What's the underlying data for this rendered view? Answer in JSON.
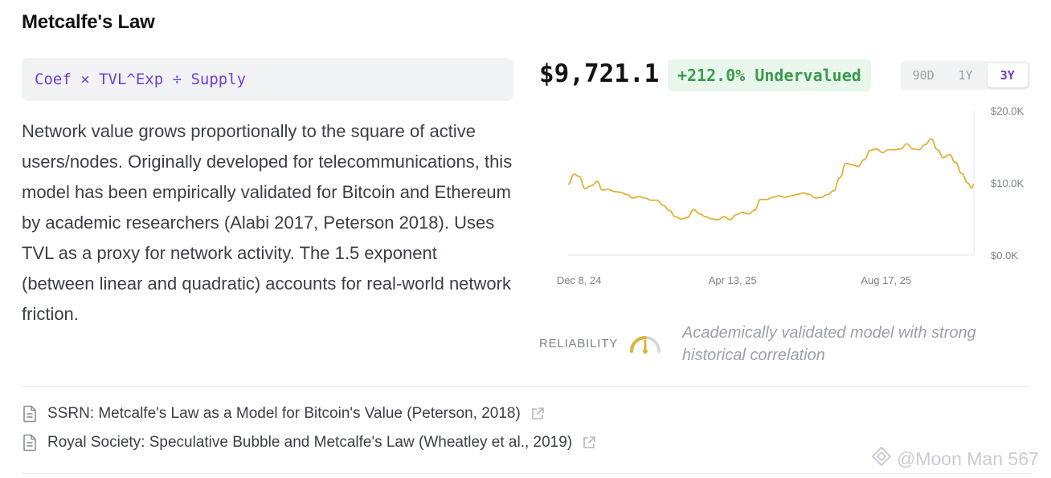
{
  "header": {
    "title": "Metcalfe's Law"
  },
  "formula": "Coef × TVL^Exp ÷ Supply",
  "description": "Network value grows proportionally to the square of active users/nodes. Originally developed for telecommunications, this model has been empirically validated for Bitcoin and Ethereum by academic researchers (Alabi 2017, Peterson 2018). Uses TVL as a proxy for network activity. The 1.5 exponent (between linear and quadratic) accounts for real-world network friction.",
  "price": "$9,721.1",
  "valuation_badge": "+212.0% Undervalued",
  "range_selector": {
    "options": [
      "90D",
      "1Y",
      "3Y"
    ],
    "selected": "3Y"
  },
  "reliability": {
    "label": "RELIABILITY",
    "note": "Academically validated model with strong historical correlation",
    "level": 0.5
  },
  "sources": [
    {
      "label": "SSRN: Metcalfe's Law as a Model for Bitcoin's Value (Peterson, 2018)",
      "icon": "document-icon",
      "link_icon": "external-link-icon"
    },
    {
      "label": "Royal Society: Speculative Bubble and Metcalfe's Law (Wheatley et al., 2019)",
      "icon": "document-icon",
      "link_icon": "external-link-icon"
    }
  ],
  "watermark": "@Moon Man 567",
  "colors": {
    "accent": "#6d3fd6",
    "line": "#e0b23a",
    "positive": "#3a9b4f",
    "badge_bg": "#e9f6ec"
  },
  "chart_data": {
    "type": "line",
    "x_ticks": [
      "Dec 8, 24",
      "Apr 13, 25",
      "Aug 17, 25"
    ],
    "y_ticks": [
      "$0.0K",
      "$10.0K",
      "$20.0K"
    ],
    "ylim": [
      0,
      20000
    ],
    "x_range": [
      "2024-11-29",
      "2025-10-28"
    ],
    "series": [
      {
        "points": [
          [
            "2024-11-29",
            9800
          ],
          [
            "2024-12-04",
            11200
          ],
          [
            "2024-12-08",
            10900
          ],
          [
            "2024-12-13",
            9200
          ],
          [
            "2024-12-18",
            9600
          ],
          [
            "2024-12-23",
            10200
          ],
          [
            "2024-12-27",
            9000
          ],
          [
            "2025-01-01",
            9100
          ],
          [
            "2025-01-06",
            8800
          ],
          [
            "2025-01-11",
            8700
          ],
          [
            "2025-01-16",
            8400
          ],
          [
            "2025-01-21",
            7900
          ],
          [
            "2025-01-26",
            8100
          ],
          [
            "2025-01-31",
            7900
          ],
          [
            "2025-02-05",
            7600
          ],
          [
            "2025-02-10",
            7600
          ],
          [
            "2025-02-15",
            6900
          ],
          [
            "2025-02-20",
            6200
          ],
          [
            "2025-02-25",
            5300
          ],
          [
            "2025-03-02",
            5000
          ],
          [
            "2025-03-07",
            5200
          ],
          [
            "2025-03-12",
            6300
          ],
          [
            "2025-03-17",
            5700
          ],
          [
            "2025-03-22",
            5300
          ],
          [
            "2025-03-27",
            5000
          ],
          [
            "2025-04-01",
            4900
          ],
          [
            "2025-04-06",
            5300
          ],
          [
            "2025-04-11",
            4900
          ],
          [
            "2025-04-16",
            5600
          ],
          [
            "2025-04-21",
            5900
          ],
          [
            "2025-04-26",
            5700
          ],
          [
            "2025-05-01",
            6200
          ],
          [
            "2025-05-06",
            7700
          ],
          [
            "2025-05-11",
            7700
          ],
          [
            "2025-05-16",
            8000
          ],
          [
            "2025-05-21",
            8200
          ],
          [
            "2025-05-26",
            8000
          ],
          [
            "2025-05-31",
            8200
          ],
          [
            "2025-06-05",
            8400
          ],
          [
            "2025-06-10",
            8600
          ],
          [
            "2025-06-15",
            8400
          ],
          [
            "2025-06-20",
            7900
          ],
          [
            "2025-06-25",
            8000
          ],
          [
            "2025-06-30",
            8400
          ],
          [
            "2025-07-05",
            8900
          ],
          [
            "2025-07-10",
            10700
          ],
          [
            "2025-07-15",
            12700
          ],
          [
            "2025-07-20",
            12500
          ],
          [
            "2025-07-25",
            12300
          ],
          [
            "2025-07-30",
            13200
          ],
          [
            "2025-08-04",
            14500
          ],
          [
            "2025-08-09",
            14700
          ],
          [
            "2025-08-14",
            14200
          ],
          [
            "2025-08-19",
            14600
          ],
          [
            "2025-08-24",
            14600
          ],
          [
            "2025-08-29",
            14700
          ],
          [
            "2025-09-03",
            15400
          ],
          [
            "2025-09-08",
            14700
          ],
          [
            "2025-09-13",
            14600
          ],
          [
            "2025-09-18",
            15300
          ],
          [
            "2025-09-23",
            16100
          ],
          [
            "2025-09-28",
            14600
          ],
          [
            "2025-10-03",
            13500
          ],
          [
            "2025-10-08",
            13900
          ],
          [
            "2025-10-13",
            12800
          ],
          [
            "2025-10-18",
            11300
          ],
          [
            "2025-10-23",
            10000
          ],
          [
            "2025-10-26",
            9300
          ],
          [
            "2025-10-28",
            9800
          ]
        ]
      }
    ],
    "grid": false
  }
}
